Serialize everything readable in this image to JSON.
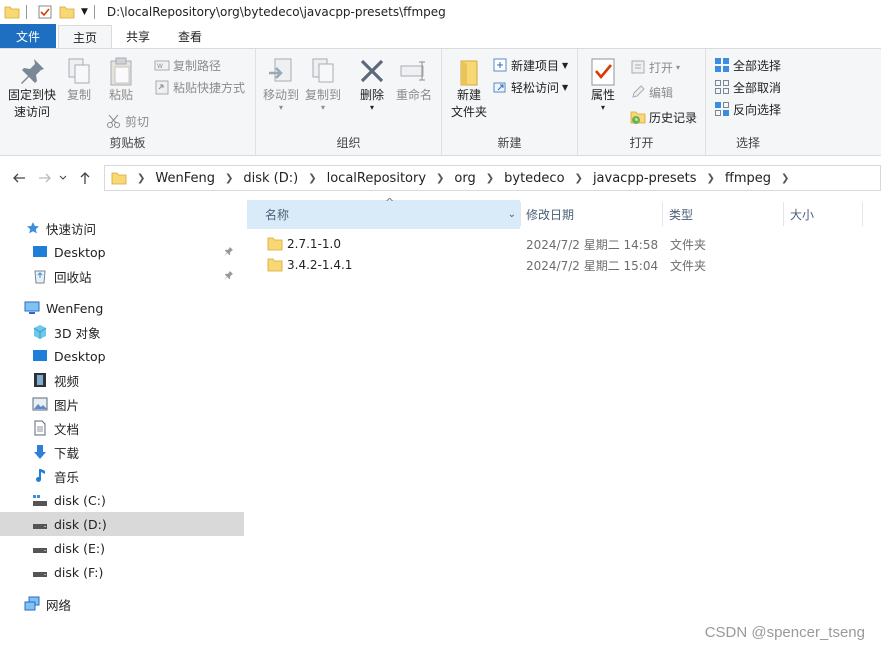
{
  "window": {
    "title": "D:\\localRepository\\org\\bytedeco\\javacpp-presets\\ffmpeg"
  },
  "tabs": [
    {
      "label": "文件"
    },
    {
      "label": "主页"
    },
    {
      "label": "共享"
    },
    {
      "label": "查看"
    }
  ],
  "ribbon": {
    "clipboard": {
      "group": "剪贴板",
      "pin": "固定到快",
      "pin2": "速访问",
      "copy": "复制",
      "paste": "粘贴",
      "copy_path": "复制路径",
      "paste_shortcut": "粘贴快捷方式",
      "cut": "剪切"
    },
    "organize": {
      "group": "组织",
      "move_to": "移动到",
      "copy_to": "复制到",
      "delete": "删除",
      "rename": "重命名"
    },
    "new": {
      "group": "新建",
      "new_folder": "新建",
      "new_folder2": "文件夹",
      "new_item": "新建项目",
      "easy_access": "轻松访问"
    },
    "open": {
      "group": "打开",
      "properties": "属性",
      "open": "打开",
      "edit": "编辑",
      "history": "历史记录"
    },
    "select": {
      "group": "选择",
      "select_all": "全部选择",
      "select_none": "全部取消",
      "invert": "反向选择"
    }
  },
  "breadcrumb": [
    "WenFeng",
    "disk (D:)",
    "localRepository",
    "org",
    "bytedeco",
    "javacpp-presets",
    "ffmpeg"
  ],
  "sidebar": {
    "quick_access": "快速访问",
    "quick_items": [
      "Desktop",
      "回收站"
    ],
    "this_pc": "WenFeng",
    "pc_items": [
      "3D 对象",
      "Desktop",
      "视频",
      "图片",
      "文档",
      "下载",
      "音乐",
      "disk (C:)",
      "disk (D:)",
      "disk (E:)",
      "disk (F:)"
    ],
    "network": "网络"
  },
  "columns": {
    "name": "名称",
    "date": "修改日期",
    "type": "类型",
    "size": "大小"
  },
  "files": [
    {
      "name": "2.7.1-1.0",
      "date": "2024/7/2 星期二 14:58",
      "type": "文件夹"
    },
    {
      "name": "3.4.2-1.4.1",
      "date": "2024/7/2 星期二 15:04",
      "type": "文件夹"
    }
  ],
  "watermark": "CSDN @spencer_tseng",
  "colors": {
    "file_tab": "#1e6fc2",
    "folder": "#f8d775",
    "selected": "#d9d9d9",
    "sorted_header": "#d9ebf9"
  }
}
